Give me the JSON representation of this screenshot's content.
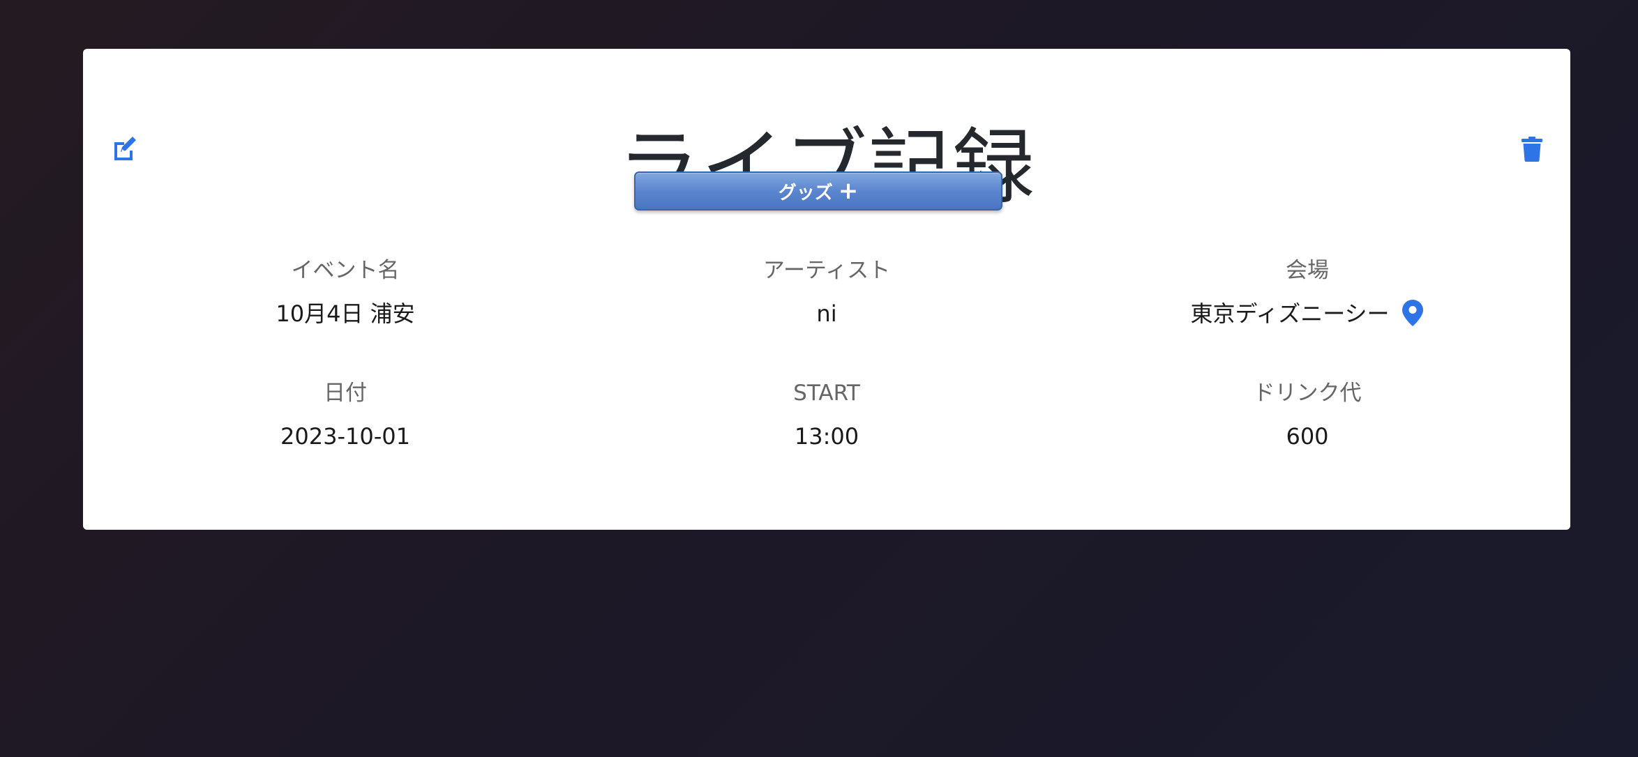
{
  "page": {
    "title": "ライブ記録",
    "goods_button_label": "グッズ",
    "goods_button_icon": "plus-icon"
  },
  "icons": {
    "edit": "edit-icon",
    "delete": "trash-icon",
    "location": "map-pin-icon"
  },
  "colors": {
    "accent": "#2f74e6",
    "button": "#5b86cf",
    "title": "#25292d",
    "label": "#666666"
  },
  "fields": {
    "event_name": {
      "label": "イベント名",
      "value": "10月4日 浦安"
    },
    "artist": {
      "label": "アーティスト",
      "value": "ni"
    },
    "venue": {
      "label": "会場",
      "value": "東京ディズニーシー"
    },
    "date": {
      "label": "日付",
      "value": "2023-10-01"
    },
    "start": {
      "label": "START",
      "value": "13:00"
    },
    "drink": {
      "label": "ドリンク代",
      "value": "600"
    }
  }
}
